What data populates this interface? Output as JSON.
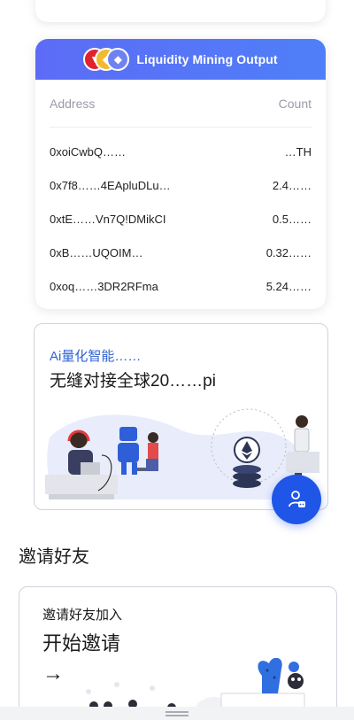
{
  "liquidity": {
    "title": "Liquidity Mining Output",
    "col_address": "Address",
    "col_count": "Count",
    "coin_icons": [
      "trx-coin-icon",
      "bnb-coin-icon",
      "eth-coin-icon"
    ],
    "rows": [
      {
        "address": "0xoiCwbQ……",
        "count": "…TH"
      },
      {
        "address": "0x7f8……4EApluDLu…",
        "count": "2.4……"
      },
      {
        "address": "0xtE……Vn7Q!DMikCI",
        "count": "0.5……"
      },
      {
        "address": "0xB……UQOIM…",
        "count": "0.32……"
      },
      {
        "address": "0xoq……3DR2RFma",
        "count": "5.24……"
      }
    ]
  },
  "ai": {
    "tag": "Ai量化智能……",
    "title": "无缝对接全球20……pi"
  },
  "invite": {
    "heading": "邀请好友",
    "subtitle": "邀请好友加入",
    "title": "开始邀请",
    "arrow": "→"
  },
  "fab": {
    "icon": "user-support-icon"
  },
  "colors": {
    "accent": "#1f56e8",
    "header_gradient_start": "#5c6cf6",
    "header_gradient_end": "#4f7ff8",
    "tag_blue": "#2f62d6"
  }
}
